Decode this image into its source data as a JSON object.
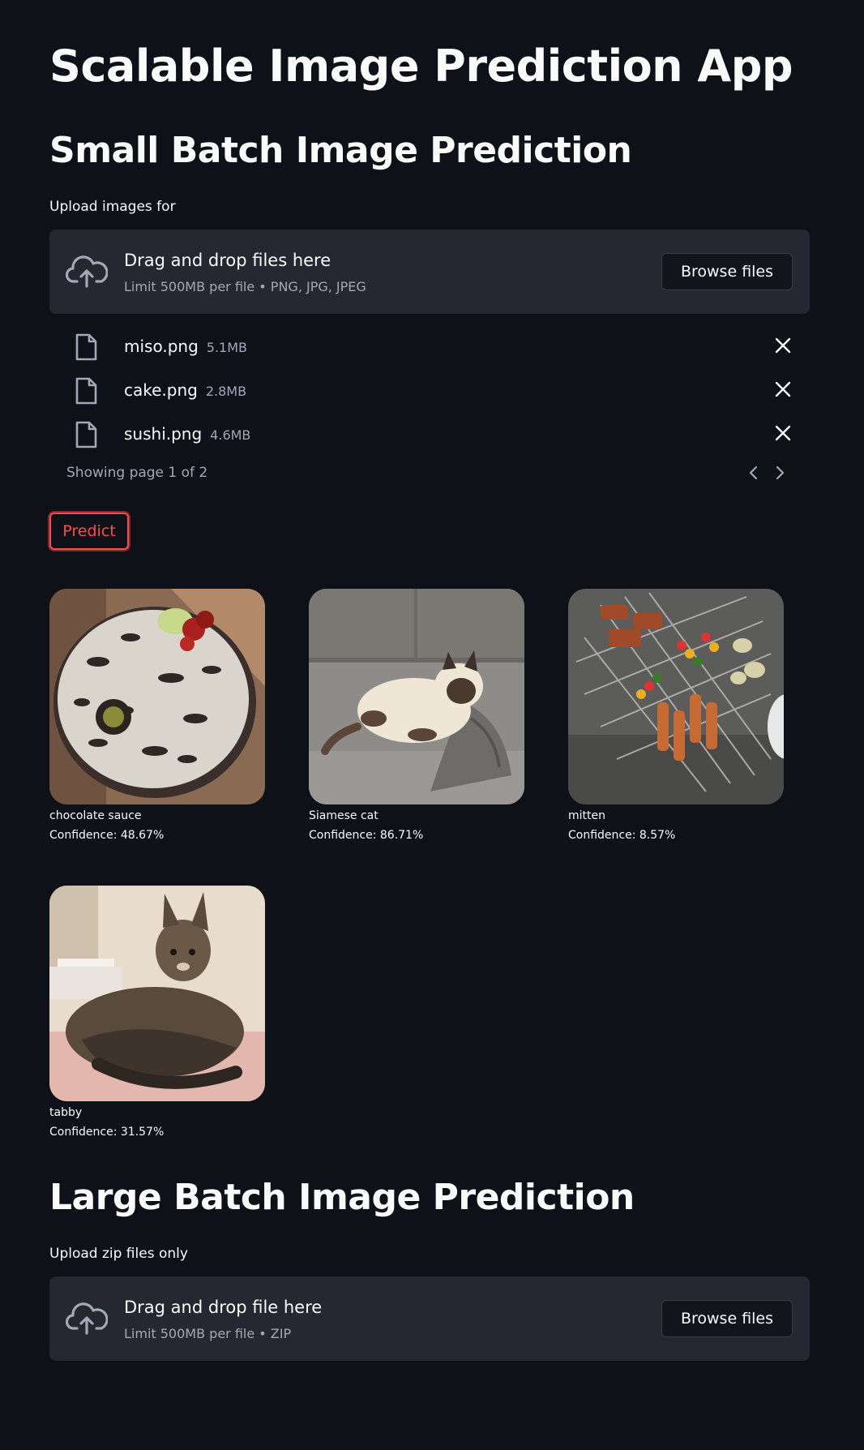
{
  "app": {
    "title": "Scalable Image Prediction App"
  },
  "small_batch": {
    "heading": "Small Batch Image Prediction",
    "upload_label": "Upload images for",
    "dropzone": {
      "title": "Drag and drop files here",
      "limit": "Limit 500MB per file • PNG, JPG, JPEG",
      "browse_label": "Browse files"
    },
    "files": [
      {
        "name": "miso.png",
        "size": "5.1MB"
      },
      {
        "name": "cake.png",
        "size": "2.8MB"
      },
      {
        "name": "sushi.png",
        "size": "4.6MB"
      }
    ],
    "pagination": {
      "text": "Showing page 1 of 2"
    },
    "predict_label": "Predict",
    "predictions": [
      {
        "label": "chocolate sauce",
        "confidence": "Confidence: 48.67%",
        "image": "cake"
      },
      {
        "label": "Siamese cat",
        "confidence": "Confidence: 86.71%",
        "image": "siamese-cat"
      },
      {
        "label": "mitten",
        "confidence": "Confidence: 8.57%",
        "image": "grill-skewers"
      },
      {
        "label": "tabby",
        "confidence": "Confidence: 31.57%",
        "image": "tabby-cat"
      }
    ]
  },
  "large_batch": {
    "heading": "Large Batch Image Prediction",
    "upload_label": "Upload zip files only",
    "dropzone": {
      "title": "Drag and drop file here",
      "limit": "Limit 500MB per file • ZIP",
      "browse_label": "Browse files"
    }
  },
  "colors": {
    "background": "#0e1117",
    "surface": "#262730",
    "primary": "#ff4b4b",
    "muted_text": "#a3a8b8"
  }
}
